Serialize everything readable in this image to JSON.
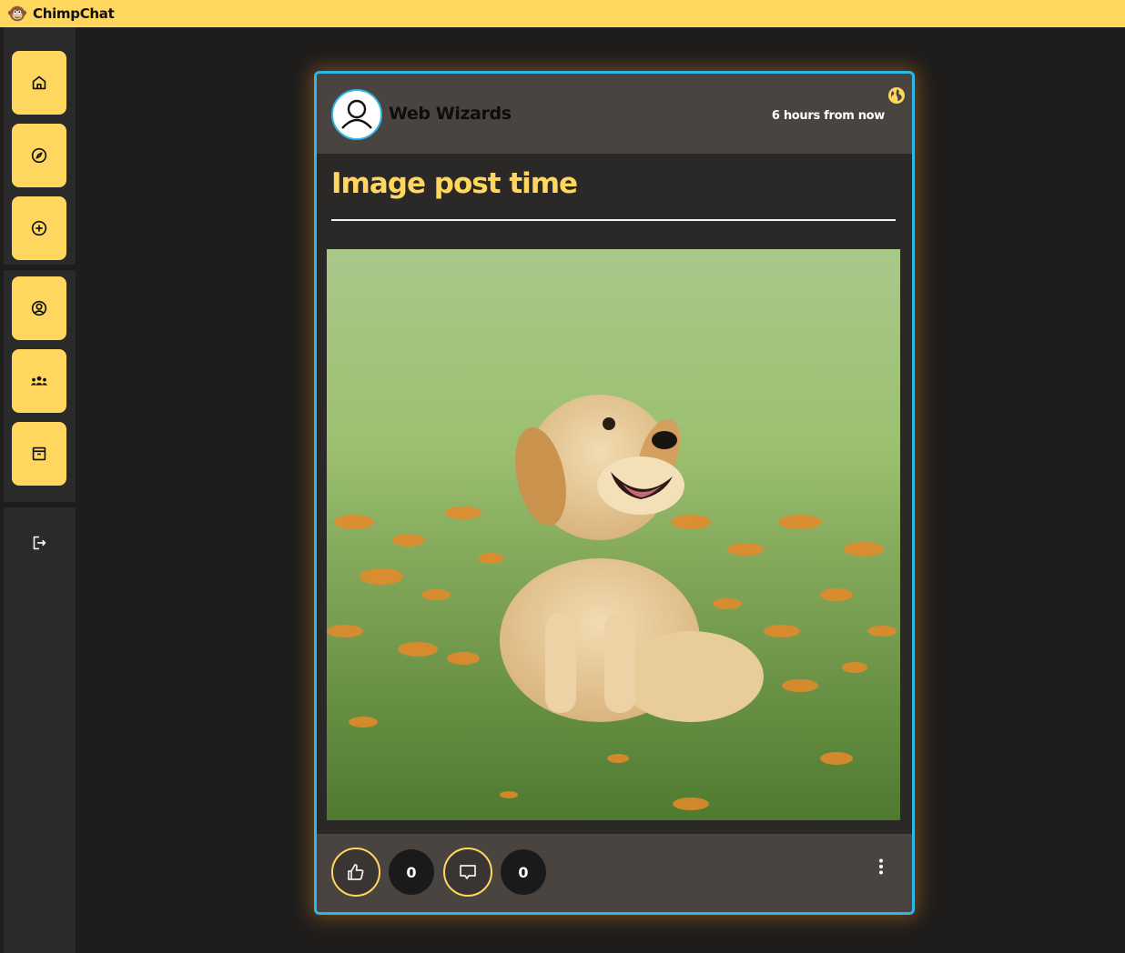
{
  "app": {
    "title": "ChimpChat",
    "accent": "#ffd75e",
    "card_border": "#2eb6e6"
  },
  "sidebar": {
    "items": [
      {
        "icon": "home-icon",
        "label": "Home"
      },
      {
        "icon": "compass-icon",
        "label": "Explore"
      },
      {
        "icon": "plus-circle-icon",
        "label": "Create"
      },
      {
        "icon": "user-circle-icon",
        "label": "Profile"
      },
      {
        "icon": "group-icon",
        "label": "Groups"
      },
      {
        "icon": "archive-icon",
        "label": "Archive"
      }
    ],
    "logout_icon": "logout-icon"
  },
  "post": {
    "author": "Web Wizards",
    "timestamp": "6 hours from now",
    "visibility_icon": "globe-icon",
    "title": "Image post time",
    "image_subject": "golden retriever puppy sitting in grass",
    "likes": "0",
    "comments": "0"
  }
}
